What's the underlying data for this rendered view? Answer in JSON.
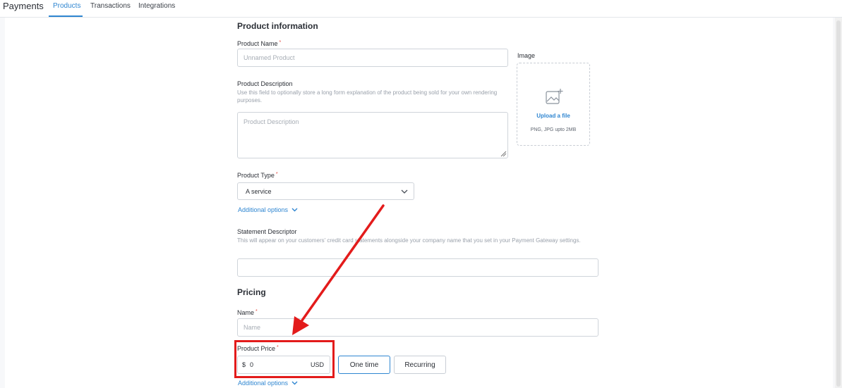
{
  "header": {
    "app_title": "Payments",
    "tabs": [
      {
        "label": "Products",
        "active": true
      },
      {
        "label": "Transactions",
        "active": false
      },
      {
        "label": "Integrations",
        "active": false
      }
    ]
  },
  "product_info": {
    "title": "Product information",
    "name": {
      "label": "Product Name",
      "required": "*",
      "placeholder": "Unnamed Product"
    },
    "description": {
      "label": "Product Description",
      "helper": "Use this field to optionally store a long form explanation of the product being sold for your own rendering purposes.",
      "placeholder": "Product Description"
    },
    "image": {
      "label": "Image",
      "upload_link": "Upload a file",
      "hint": "PNG, JPG upto 2MB",
      "icon": "image-add-icon"
    },
    "type": {
      "label": "Product Type",
      "required": "*",
      "value": "A service"
    },
    "additional_options": "Additional options",
    "statement": {
      "label": "Statement Descriptor",
      "helper": "This will appear on your customers' credit card statements alongside your company name that you set in your Payment Gateway settings.",
      "value": ""
    }
  },
  "pricing": {
    "title": "Pricing",
    "name": {
      "label": "Name",
      "required": "*",
      "placeholder": "Name"
    },
    "price": {
      "label": "Product Price",
      "required": "*",
      "currency_symbol": "$",
      "value": "0",
      "currency": "USD"
    },
    "billing_options": [
      "One time",
      "Recurring"
    ],
    "selected_billing": "One time",
    "additional_options": "Additional options"
  },
  "colors": {
    "accent": "#2f86d1",
    "annotation": "#e31b1b",
    "required": "#e0483e"
  }
}
